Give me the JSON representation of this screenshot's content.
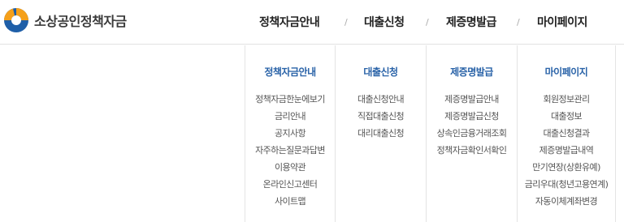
{
  "brand": {
    "name": "소상공인정책자금"
  },
  "gnb": {
    "items": [
      {
        "label": "정책자금안내"
      },
      {
        "label": "대출신청"
      },
      {
        "label": "제증명발급"
      },
      {
        "label": "마이페이지"
      }
    ],
    "separator": "/"
  },
  "submenu": [
    {
      "title": "정책자금안내",
      "links": [
        "정책자금한눈에보기",
        "금리안내",
        "공지사항",
        "자주하는질문과답변",
        "이용약관",
        "온라인신고센터",
        "사이트맵"
      ]
    },
    {
      "title": "대출신청",
      "links": [
        "대출신청안내",
        "직접대출신청",
        "대리대출신청"
      ]
    },
    {
      "title": "제증명발급",
      "links": [
        "제증명발급안내",
        "제증명발급신청",
        "상속인금융거래조회",
        "정책자금확인서확인"
      ]
    },
    {
      "title": "마이페이지",
      "links": [
        "회원정보관리",
        "대출정보",
        "대출신청결과",
        "제증명발급내역",
        "만기연장(상환유예)",
        "금리우대(청년고용연계)",
        "자동이체계좌변경"
      ]
    }
  ],
  "colors": {
    "accent_blue": "#2a63a8",
    "logo_orange": "#f5a01a",
    "logo_blue": "#1f5fa8"
  }
}
